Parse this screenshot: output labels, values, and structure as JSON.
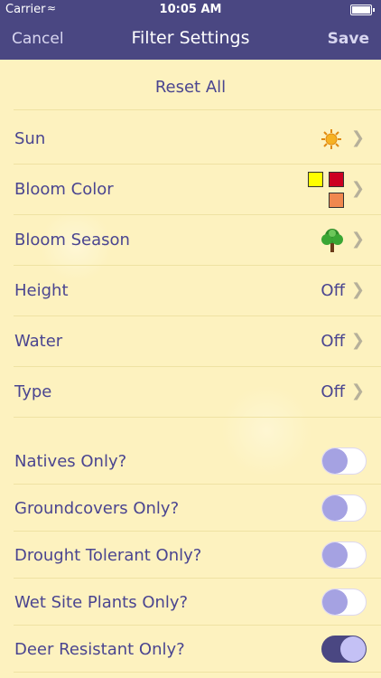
{
  "status_bar": {
    "carrier": "Carrier",
    "time": "10:05 AM"
  },
  "nav": {
    "cancel_label": "Cancel",
    "title": "Filter Settings",
    "save_label": "Save"
  },
  "reset_label": "Reset All",
  "filters": [
    {
      "label": "Sun",
      "value": "",
      "icon": "sun-icon"
    },
    {
      "label": "Bloom Color",
      "value": "",
      "icon": "color-swatches-icon",
      "colors": [
        "#ffff00",
        "#cc0022",
        "#f0884f"
      ]
    },
    {
      "label": "Bloom Season",
      "value": "",
      "icon": "tree-icon"
    },
    {
      "label": "Height",
      "value": "Off"
    },
    {
      "label": "Water",
      "value": "Off"
    },
    {
      "label": "Type",
      "value": "Off"
    }
  ],
  "toggles": [
    {
      "label": "Natives Only?",
      "on": false
    },
    {
      "label": "Groundcovers Only?",
      "on": false
    },
    {
      "label": "Drought Tolerant Only?",
      "on": false
    },
    {
      "label": "Wet Site Plants Only?",
      "on": false
    },
    {
      "label": "Deer Resistant Only?",
      "on": true
    }
  ]
}
